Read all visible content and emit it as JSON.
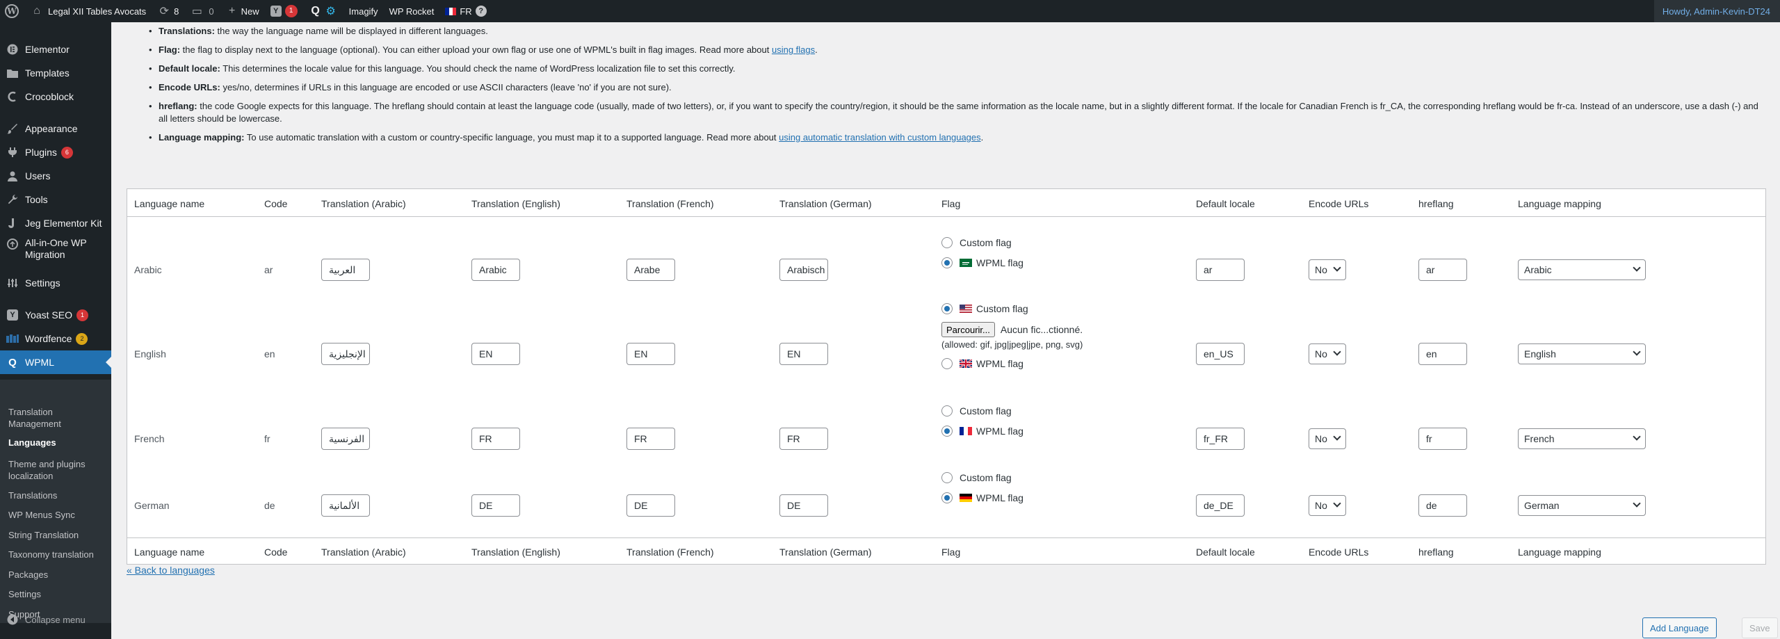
{
  "adminbar": {
    "site_name": "Legal XII Tables Avocats",
    "updates_count": "8",
    "comments_count": "0",
    "new_label": "New",
    "yoast_count": "1",
    "imagify_label": "Imagify",
    "wprocket_label": "WP Rocket",
    "lang_label": "FR",
    "howdy": "Howdy, Admin-Kevin-DT24"
  },
  "sidebar": {
    "items": [
      {
        "label": "Elementor",
        "icon": "elementor-icon"
      },
      {
        "label": "Templates",
        "icon": "folder-icon"
      },
      {
        "label": "Crocoblock",
        "icon": "crocoblock-icon"
      },
      {
        "label": "Appearance",
        "icon": "paintbrush-icon"
      },
      {
        "label": "Plugins",
        "icon": "plug-icon",
        "badge": "6"
      },
      {
        "label": "Users",
        "icon": "users-icon"
      },
      {
        "label": "Tools",
        "icon": "wrench-icon"
      },
      {
        "label": "Jeg Elementor Kit",
        "icon": "jeg-icon"
      },
      {
        "label": "All-in-One WP Migration",
        "icon": "migration-icon"
      },
      {
        "label": "Settings",
        "icon": "settings-icon"
      },
      {
        "label": "Yoast SEO",
        "icon": "yoast-icon",
        "badge": "1"
      },
      {
        "label": "Wordfence",
        "icon": "wordfence-icon",
        "badge": "2"
      },
      {
        "label": "WPML",
        "icon": "wpml-icon"
      }
    ],
    "submenu": [
      "Translation Management",
      "Languages",
      "Theme and plugins localization",
      "Translations",
      "WP Menus Sync",
      "String Translation",
      "Taxonomy translation",
      "Packages",
      "Settings",
      "Support"
    ],
    "collapse_label": "Collapse menu"
  },
  "legend": {
    "translations": {
      "term": "Translations:",
      "text": " the way the language name will be displayed in different languages."
    },
    "flag": {
      "term": "Flag:",
      "text": " the flag to display next to the language (optional). You can either upload your own flag or use one of WPML's built in flag images. Read more about ",
      "link": "using flags",
      "tail": "."
    },
    "locale": {
      "term": "Default locale:",
      "text": " This determines the locale value for this language. You should check the name of WordPress localization file to set this correctly."
    },
    "encode": {
      "term": "Encode URLs:",
      "text": " yes/no, determines if URLs in this language are encoded or use ASCII characters (leave 'no' if you are not sure)."
    },
    "hreflang": {
      "term": "hreflang:",
      "text": " the code Google expects for this language. The hreflang should contain at least the language code (usually, made of two letters), or, if you want to specify the country/region, it should be the same information as the locale name, but in a slightly different format. If the locale for Canadian French is fr_CA, the corresponding hreflang would be fr-ca. Instead of an underscore, use a dash (-) and all letters should be lowercase."
    },
    "mapping": {
      "term": "Language mapping:",
      "text": " To use automatic translation with a custom or country-specific language, you must map it to a supported language. Read more about ",
      "link": "using automatic translation with custom languages",
      "tail": "."
    }
  },
  "table": {
    "headers": [
      "Language name",
      "Code",
      "Translation (Arabic)",
      "Translation (English)",
      "Translation (French)",
      "Translation (German)",
      "Flag",
      "Default locale",
      "Encode URLs",
      "hreflang",
      "Language mapping"
    ],
    "rows": [
      {
        "name": "Arabic",
        "code": "ar",
        "tr_ar": "العربية",
        "tr_en": "Arabic",
        "tr_fr": "Arabe",
        "tr_de": "Arabisch",
        "custom_flag_label": "Custom flag",
        "wpml_flag_label": "WPML flag",
        "locale": "ar",
        "encode": "No",
        "hreflang": "ar",
        "mapping": "Arabic"
      },
      {
        "name": "English",
        "code": "en",
        "tr_ar": "الإنجليزية",
        "tr_en": "EN",
        "tr_fr": "EN",
        "tr_de": "EN",
        "custom_flag_label": "Custom flag",
        "wpml_flag_label": "WPML flag",
        "file_button": "Parcourir...",
        "file_status": "Aucun fic...ctionné.",
        "allowed": "(allowed: gif, jpg|jpeg|jpe, png, svg)",
        "locale": "en_US",
        "encode": "No",
        "hreflang": "en",
        "mapping": "English"
      },
      {
        "name": "French",
        "code": "fr",
        "tr_ar": "الفرنسية",
        "tr_en": "FR",
        "tr_fr": "FR",
        "tr_de": "FR",
        "custom_flag_label": "Custom flag",
        "wpml_flag_label": "WPML flag",
        "locale": "fr_FR",
        "encode": "No",
        "hreflang": "fr",
        "mapping": "French"
      },
      {
        "name": "German",
        "code": "de",
        "tr_ar": "الألمانية",
        "tr_en": "DE",
        "tr_fr": "DE",
        "tr_de": "DE",
        "custom_flag_label": "Custom flag",
        "wpml_flag_label": "WPML flag",
        "locale": "de_DE",
        "encode": "No",
        "hreflang": "de",
        "mapping": "German"
      }
    ]
  },
  "actions": {
    "back_link": "« Back to languages",
    "add_language": "Add Language",
    "save": "Save"
  }
}
